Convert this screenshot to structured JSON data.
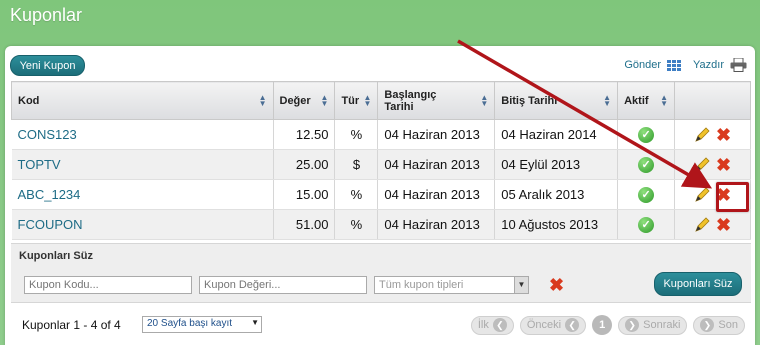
{
  "page": {
    "title": "Kuponlar"
  },
  "toolbar": {
    "new_label": "Yeni Kupon",
    "send_label": "Gönder",
    "print_label": "Yazdır"
  },
  "table": {
    "headers": {
      "code": "Kod",
      "value": "Değer",
      "type": "Tür",
      "start_line1": "Başlangıç",
      "start_line2": "Tarihi",
      "end": "Bitiş Tarihi",
      "active": "Aktif"
    },
    "rows": [
      {
        "code": "CONS123",
        "value": "12.50",
        "type": "%",
        "start": "04 Haziran 2013",
        "end": "04 Haziran 2014"
      },
      {
        "code": "TOPTV",
        "value": "25.00",
        "type": "$",
        "start": "04 Haziran 2013",
        "end": "04 Eylül 2013"
      },
      {
        "code": "ABC_1234",
        "value": "15.00",
        "type": "%",
        "start": "04 Haziran 2013",
        "end": "05 Aralık 2013"
      },
      {
        "code": "FCOUPON",
        "value": "51.00",
        "type": "%",
        "start": "04 Haziran 2013",
        "end": "10 Ağustos 2013"
      }
    ]
  },
  "filter": {
    "title": "Kuponları Süz",
    "code_placeholder": "Kupon Kodu...",
    "value_placeholder": "Kupon Değeri...",
    "type_selected": "Tüm kupon tipleri",
    "button_label": "Kuponları Süz"
  },
  "footer": {
    "count_text": "Kuponlar 1 - 4 of 4",
    "per_page": "20 Sayfa başı kayıt",
    "first": "İlk",
    "prev": "Önceki",
    "current_page": "1",
    "next": "Sonraki",
    "last": "Son"
  },
  "colors": {
    "background": "#86c783",
    "accent_button": "#1c6d79",
    "link": "#1e6c86",
    "delete": "#d93a1e",
    "callout": "#b0151a"
  }
}
